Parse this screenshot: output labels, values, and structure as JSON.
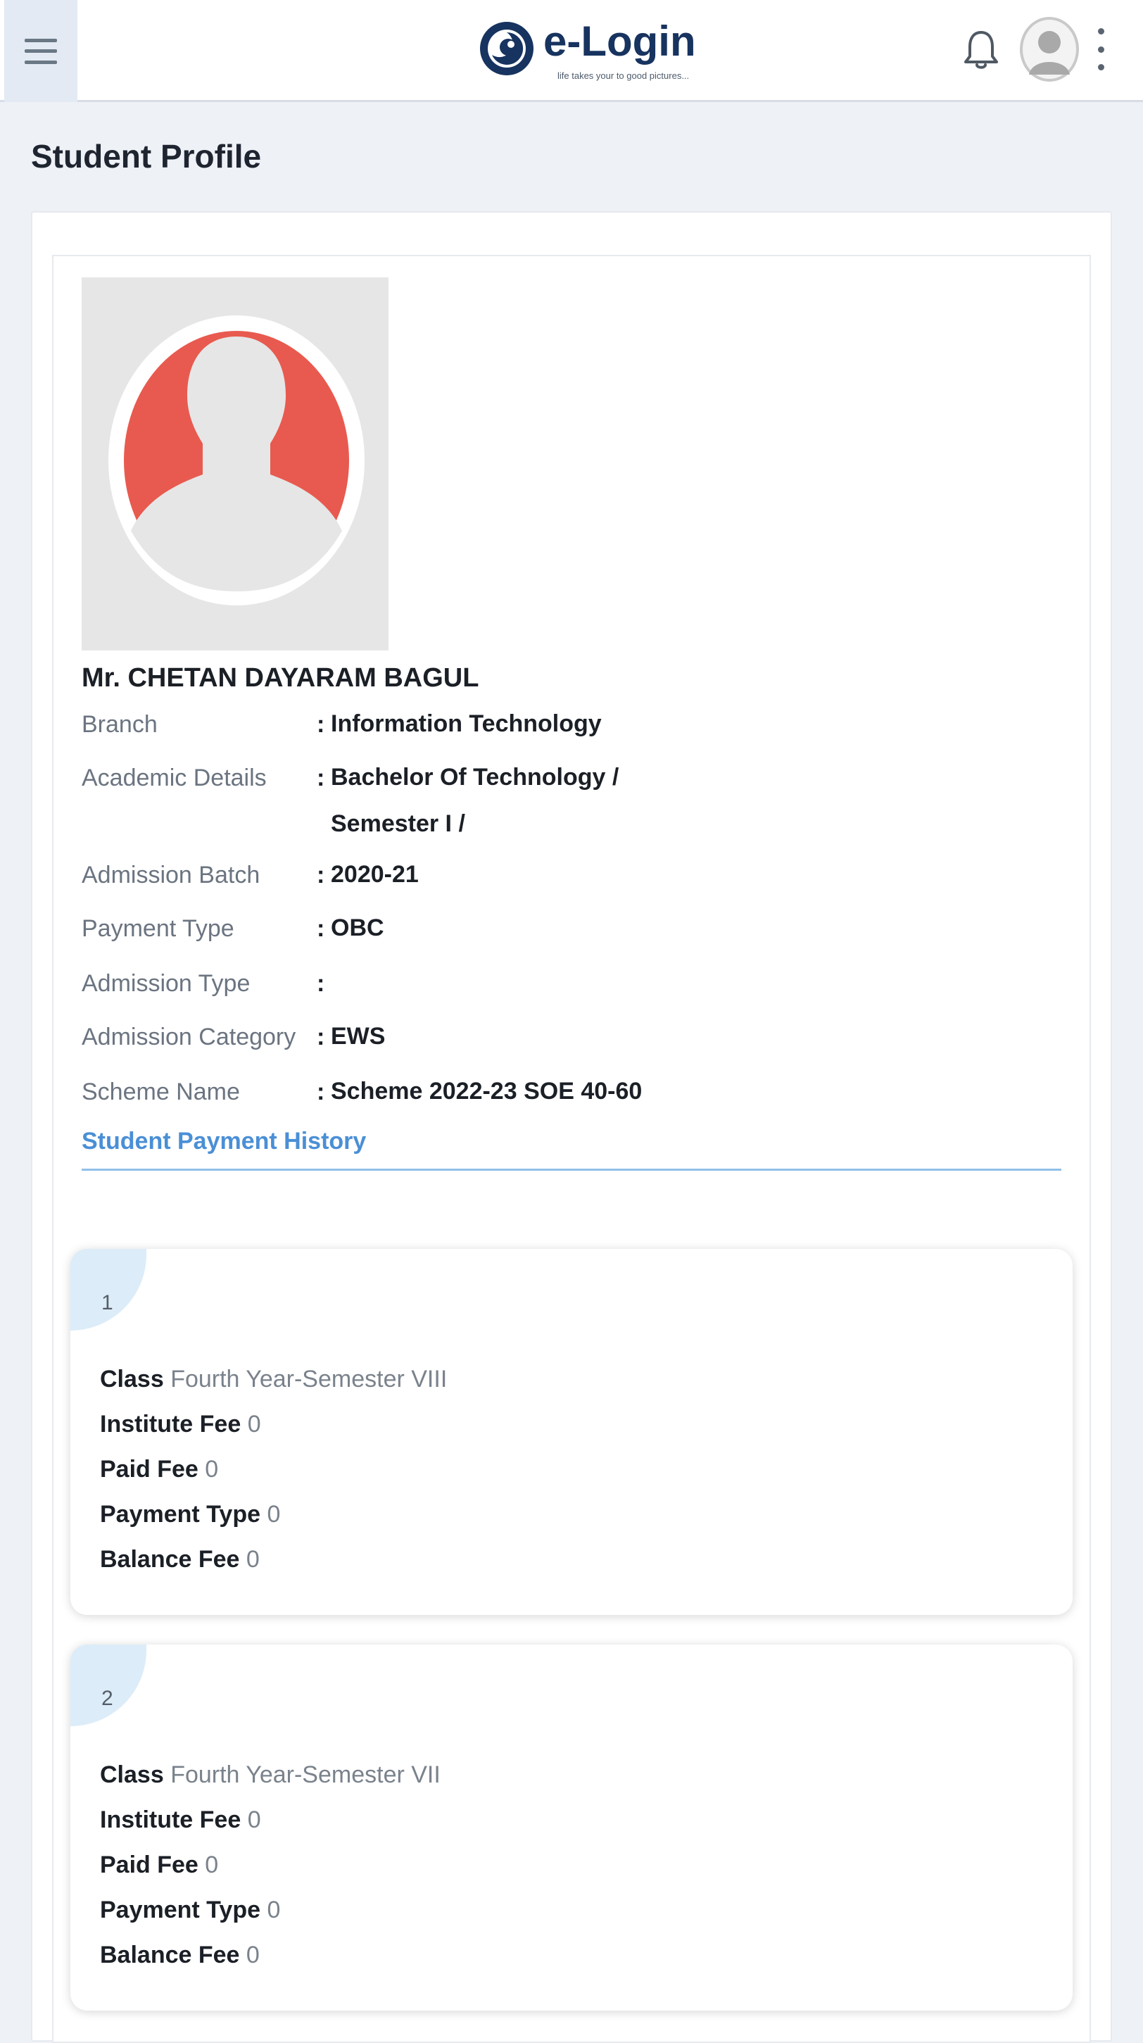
{
  "header": {
    "logo_text": "e-Login",
    "logo_tagline": "life takes your to good pictures..."
  },
  "page": {
    "title": "Student Profile"
  },
  "student": {
    "name": "Mr. CHETAN DAYARAM BAGUL",
    "fields": [
      {
        "label": "Branch",
        "value": "Information Technology"
      },
      {
        "label": "Academic Details",
        "value": "Bachelor Of Technology / Semester I /"
      },
      {
        "label": "Admission Batch",
        "value": "2020-21"
      },
      {
        "label": "Payment Type",
        "value": "OBC"
      },
      {
        "label": "Admission Type",
        "value": ""
      },
      {
        "label": "Admission Category",
        "value": "EWS"
      },
      {
        "label": "Scheme Name",
        "value": "Scheme 2022-23 SOE 40-60"
      }
    ]
  },
  "tabs": {
    "payment_history": "Student Payment History"
  },
  "payments": [
    {
      "index": "1",
      "class_label": "Class",
      "class_value": "Fourth Year-Semester VIII",
      "institute_fee_label": "Institute Fee",
      "institute_fee_value": "0",
      "paid_fee_label": "Paid Fee",
      "paid_fee_value": "0",
      "payment_type_label": "Payment Type",
      "payment_type_value": "0",
      "balance_fee_label": "Balance Fee",
      "balance_fee_value": "0"
    },
    {
      "index": "2",
      "class_label": "Class",
      "class_value": "Fourth Year-Semester VII",
      "institute_fee_label": "Institute Fee",
      "institute_fee_value": "0",
      "paid_fee_label": "Paid Fee",
      "paid_fee_value": "0",
      "payment_type_label": "Payment Type",
      "payment_type_value": "0",
      "balance_fee_label": "Balance Fee",
      "balance_fee_value": "0"
    }
  ],
  "icons": {
    "menu": "hamburger-menu-icon",
    "notifications": "bell-icon",
    "user": "user-avatar-icon",
    "more": "more-vertical-icon",
    "profile_photo": "default-person-icon"
  },
  "colors": {
    "brand": "#17335f",
    "accent": "#4a8fd6",
    "avatar_red": "#e85a4f"
  }
}
